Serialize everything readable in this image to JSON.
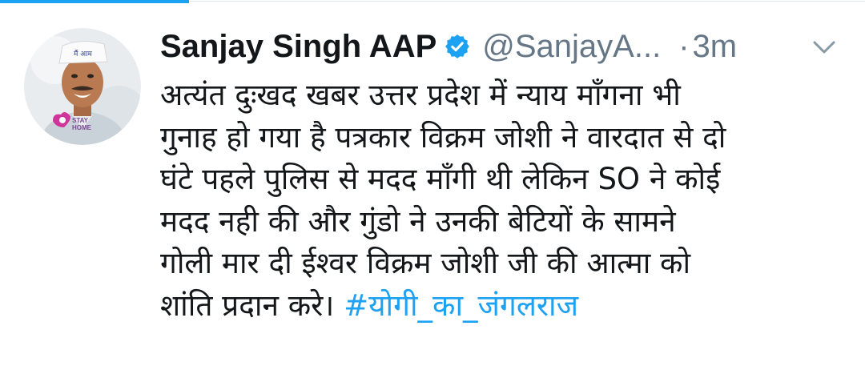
{
  "tweet": {
    "author_name": "Sanjay Singh AAP",
    "handle": "@SanjayA...",
    "separator": "·",
    "timestamp": "3m",
    "avatar_badge": "STAY\nHOME",
    "avatar_badge_line1": "STAY",
    "avatar_badge_line2": "HOME",
    "text_lines": [
      "अत्यंत दुःखद खबर उत्तर प्रदेश में न्याय माँगना भी",
      "गुनाह हो गया है पत्रकार विक्रम जोशी ने वारदात से दो",
      "घंटे पहले पुलिस से मदद माँगी थी लेकिन SO ने कोई",
      "मदद नही की और गुंडो ने उनकी बेटियों के सामने",
      "गोली मार दी ईश्वर विक्रम जोशी जी की आत्मा को"
    ],
    "last_line_text": "शांति प्रदान करे। ",
    "hashtag": "#योगी_का_जंगलराज"
  },
  "icons": {
    "verified": "verified-badge-icon",
    "menu": "chevron-down-icon"
  },
  "colors": {
    "accent": "#1da1f2",
    "text": "#14171a",
    "muted": "#657786",
    "divider": "#e1e8ed"
  }
}
